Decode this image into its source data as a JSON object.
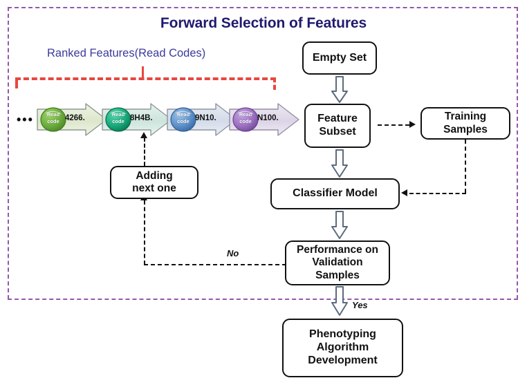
{
  "figure": {
    "title": "Forward Selection of Features",
    "title_color": "#1f1a6e",
    "frame_color": "#9457ab",
    "bracket_color": "#e8473f"
  },
  "ranked_features": {
    "label": "Ranked Features(Read Codes)",
    "label_color": "#3a3a9e",
    "ellipsis": "•••",
    "badge_text_line1": "Read",
    "badge_text_line2": "code",
    "items": [
      {
        "code": "4266.",
        "badge_color": "#6aab3c",
        "arrow_fill": "#dfe8cf"
      },
      {
        "code": "8H4B.",
        "badge_color": "#15a878",
        "arrow_fill": "#cfe4de"
      },
      {
        "code": "9N10.",
        "badge_color": "#5b8fc9",
        "arrow_fill": "#d5dde8"
      },
      {
        "code": "N100.",
        "badge_color": "#9b6fc0",
        "arrow_fill": "#ddd6e6"
      }
    ]
  },
  "nodes": {
    "empty_set": "Empty Set",
    "feature_subset": "Feature\nSubset",
    "feature_subset_line1": "Feature",
    "feature_subset_line2": "Subset",
    "training_samples_line1": "Training",
    "training_samples_line2": "Samples",
    "classifier_model": "Classifier Model",
    "performance_line1": "Performance on",
    "performance_line2": "Validation",
    "performance_line3": "Samples",
    "adding_next_line1": "Adding",
    "adding_next_line2": "next one",
    "phenotyping_line1": "Phenotyping",
    "phenotyping_line2": "Algorithm",
    "phenotyping_line3": "Development"
  },
  "edges": {
    "no_label": "No",
    "yes_label": "Yes"
  }
}
